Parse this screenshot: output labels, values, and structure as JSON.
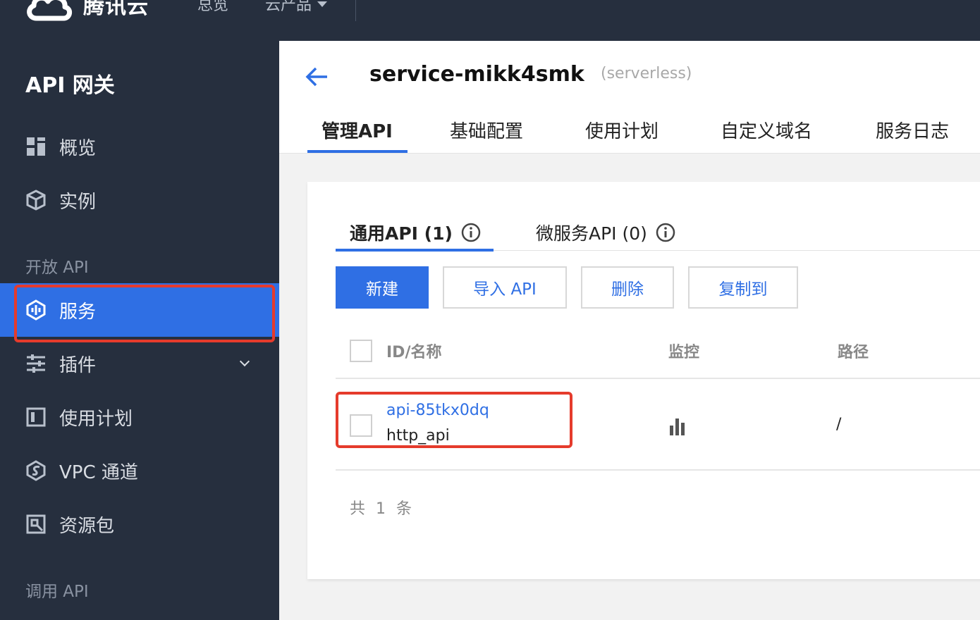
{
  "topbar": {
    "brand": "腾讯云",
    "nav": [
      "总览",
      "云产品"
    ]
  },
  "sidebar": {
    "title": "API 网关",
    "items": [
      {
        "label": "概览",
        "icon": "dashboard-icon"
      },
      {
        "label": "实例",
        "icon": "cube-icon"
      }
    ],
    "section_open_api": "开放 API",
    "open_items": [
      {
        "label": "服务",
        "icon": "service-icon"
      },
      {
        "label": "插件",
        "icon": "plugin-icon"
      },
      {
        "label": "使用计划",
        "icon": "plan-icon"
      },
      {
        "label": "VPC 通道",
        "icon": "vpc-icon"
      },
      {
        "label": "资源包",
        "icon": "package-icon"
      }
    ],
    "section_call_api": "调用 API"
  },
  "header": {
    "service_name": "service-mikk4smk",
    "service_tag": "(serverless)",
    "tabs": [
      "管理API",
      "基础配置",
      "使用计划",
      "自定义域名",
      "服务日志"
    ]
  },
  "card": {
    "subtabs": [
      "通用API (1)",
      "微服务API (0)"
    ],
    "buttons": {
      "new": "新建",
      "import": "导入 API",
      "delete": "删除",
      "copy": "复制到"
    },
    "table": {
      "columns": [
        "ID/名称",
        "监控",
        "路径"
      ],
      "rows": [
        {
          "id": "api-85tkx0dq",
          "name": "http_api",
          "path": "/"
        }
      ]
    },
    "total_text": "共 1 条"
  },
  "colors": {
    "primary": "#2f6fe4",
    "highlight": "#e53b2c",
    "sidebar_bg": "#262f3e"
  }
}
